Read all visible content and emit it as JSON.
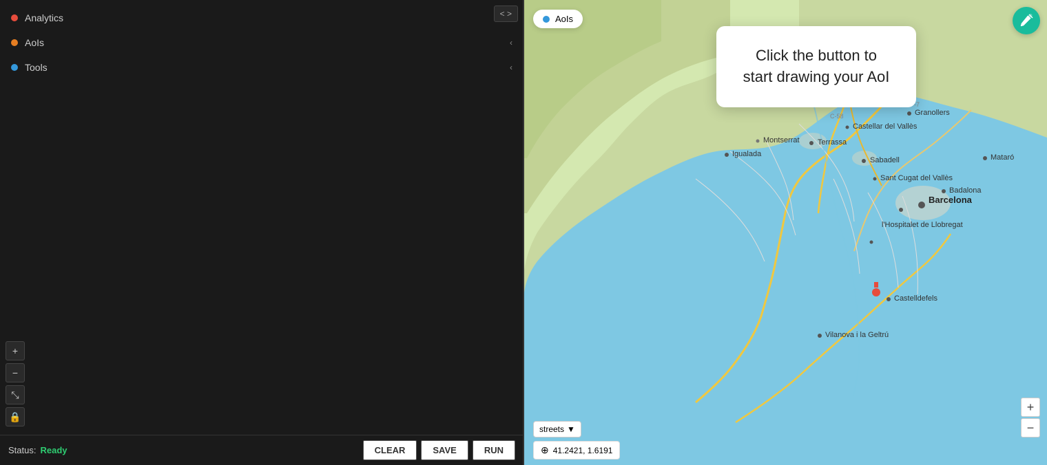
{
  "sidebar": {
    "items": [
      {
        "label": "Analytics",
        "dot_color": "red",
        "id": "analytics"
      },
      {
        "label": "AoIs",
        "dot_color": "orange",
        "id": "aois"
      },
      {
        "label": "Tools",
        "dot_color": "blue",
        "id": "tools"
      }
    ]
  },
  "status": {
    "label": "Status:",
    "value": "Ready"
  },
  "buttons": {
    "clear": "CLEAR",
    "save": "SAVE",
    "run": "RUN"
  },
  "map": {
    "tooltip": "Click the button to start drawing your AoI",
    "aoi_badge": "AoIs",
    "layer_select": "streets",
    "coords": "41.2421, 1.6191"
  },
  "code_toggle": "< >",
  "zoom": {
    "plus": "+",
    "minus": "−"
  },
  "icons": {
    "chevron": "‹",
    "location": "⊕",
    "layers": "▼",
    "draw": "✎",
    "expand": "⤡",
    "lock": "🔒",
    "zoom_in": "+",
    "zoom_out": "−"
  }
}
